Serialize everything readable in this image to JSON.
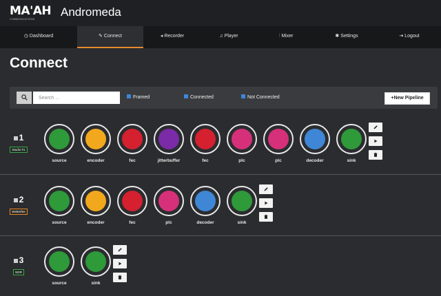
{
  "header": {
    "logo_text": "MA'AH",
    "logo_sub": "COMMUNICATIONS",
    "app_title": "Andromeda"
  },
  "nav": [
    {
      "label": "Dashboard",
      "icon": "dashboard-icon",
      "glyph": "◷",
      "active": false
    },
    {
      "label": "Connect",
      "icon": "pencil-icon",
      "glyph": "✎",
      "active": true
    },
    {
      "label": "Recorder",
      "icon": "recorder-icon",
      "glyph": "◂",
      "active": false
    },
    {
      "label": "Player",
      "icon": "headphones-icon",
      "glyph": "♫",
      "active": false
    },
    {
      "label": "Mixer",
      "icon": "mixer-icon",
      "glyph": "⫶",
      "active": false
    },
    {
      "label": "Settings",
      "icon": "gear-icon",
      "glyph": "✱",
      "active": false
    },
    {
      "label": "Logout",
      "icon": "logout-icon",
      "glyph": "⇥",
      "active": false
    }
  ],
  "page_title": "Connect",
  "filters": {
    "search_placeholder": "Search ...",
    "checks": [
      "Framed",
      "Connected",
      "Not Connected"
    ],
    "new_pipeline_label": "+New Pipeline"
  },
  "colors": {
    "green": "#2e9a3a",
    "orange": "#f2a81d",
    "red": "#d4202f",
    "purple": "#7b2aa8",
    "pink": "#d6307a",
    "blue": "#3f87d6",
    "accent": "#e58a2f",
    "check": "#3b86d9"
  },
  "pipelines": [
    {
      "number": "1",
      "tag": "Studio #1",
      "tag_color": "green",
      "nodes": [
        {
          "label": "source",
          "color": "#2e9a3a"
        },
        {
          "label": "encoder",
          "color": "#f2a81d"
        },
        {
          "label": "fec",
          "color": "#d4202f"
        },
        {
          "label": "jitterbuffer",
          "color": "#7b2aa8"
        },
        {
          "label": "fec",
          "color": "#d4202f"
        },
        {
          "label": "plc",
          "color": "#d6307a"
        },
        {
          "label": "plc",
          "color": "#d6307a"
        },
        {
          "label": "decoder",
          "color": "#3f87d6"
        },
        {
          "label": "sink",
          "color": "#2e9a3a"
        }
      ]
    },
    {
      "number": "2",
      "tag": "Wetterfee",
      "tag_color": "orange",
      "nodes": [
        {
          "label": "source",
          "color": "#2e9a3a"
        },
        {
          "label": "encoder",
          "color": "#f2a81d"
        },
        {
          "label": "fec",
          "color": "#d4202f"
        },
        {
          "label": "plc",
          "color": "#d6307a"
        },
        {
          "label": "decoder",
          "color": "#3f87d6"
        },
        {
          "label": "sink",
          "color": "#2e9a3a"
        }
      ]
    },
    {
      "number": "3",
      "tag": "NDR",
      "tag_color": "green",
      "nodes": [
        {
          "label": "source",
          "color": "#2e9a3a"
        },
        {
          "label": "sink",
          "color": "#2e9a3a"
        }
      ]
    }
  ],
  "actions": [
    {
      "name": "edit-pipeline-button",
      "icon": "pencil-icon"
    },
    {
      "name": "play-pipeline-button",
      "icon": "play-icon"
    },
    {
      "name": "delete-pipeline-button",
      "icon": "trash-icon"
    }
  ]
}
